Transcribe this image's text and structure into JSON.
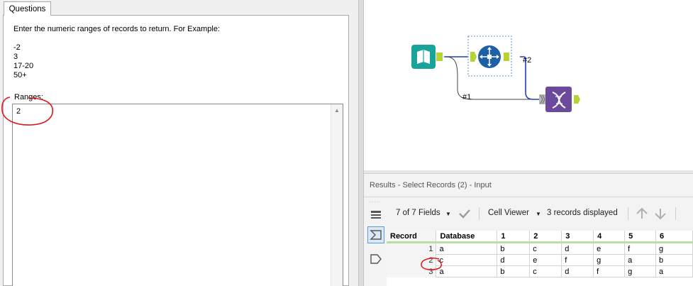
{
  "left_panel": {
    "tab_label": "Questions",
    "instruction": "Enter the numeric ranges of records to return.  For Example:",
    "examples": [
      "-2",
      "3",
      "17-20",
      "50+"
    ],
    "ranges_label": "Ranges:",
    "ranges_value": "2"
  },
  "canvas": {
    "connections": [
      "#1",
      "#2"
    ],
    "tools": [
      "input-data-tool-icon",
      "select-records-tool-icon",
      "join-tool-icon"
    ]
  },
  "results": {
    "title": "Results - Select Records (2) - Input",
    "fields_label": "7 of 7 Fields",
    "viewer_label": "Cell Viewer",
    "records_label": "3 records displayed",
    "columns": [
      "Record",
      "Database",
      "1",
      "2",
      "3",
      "4",
      "5",
      "6"
    ],
    "rows": [
      [
        "1",
        "a",
        "b",
        "c",
        "d",
        "e",
        "f",
        "g"
      ],
      [
        "2",
        "c",
        "d",
        "e",
        "f",
        "g",
        "a",
        "b"
      ],
      [
        "3",
        "a",
        "b",
        "c",
        "d",
        "f",
        "g",
        "a"
      ]
    ]
  },
  "colors": {
    "input_tool": "#1aa39a",
    "select_tool": "#1f5fa6",
    "join_tool": "#6b4a9c",
    "anchor": "#b5d334",
    "annotation": "#e3141b",
    "header_underline": "#b9dfa6"
  }
}
